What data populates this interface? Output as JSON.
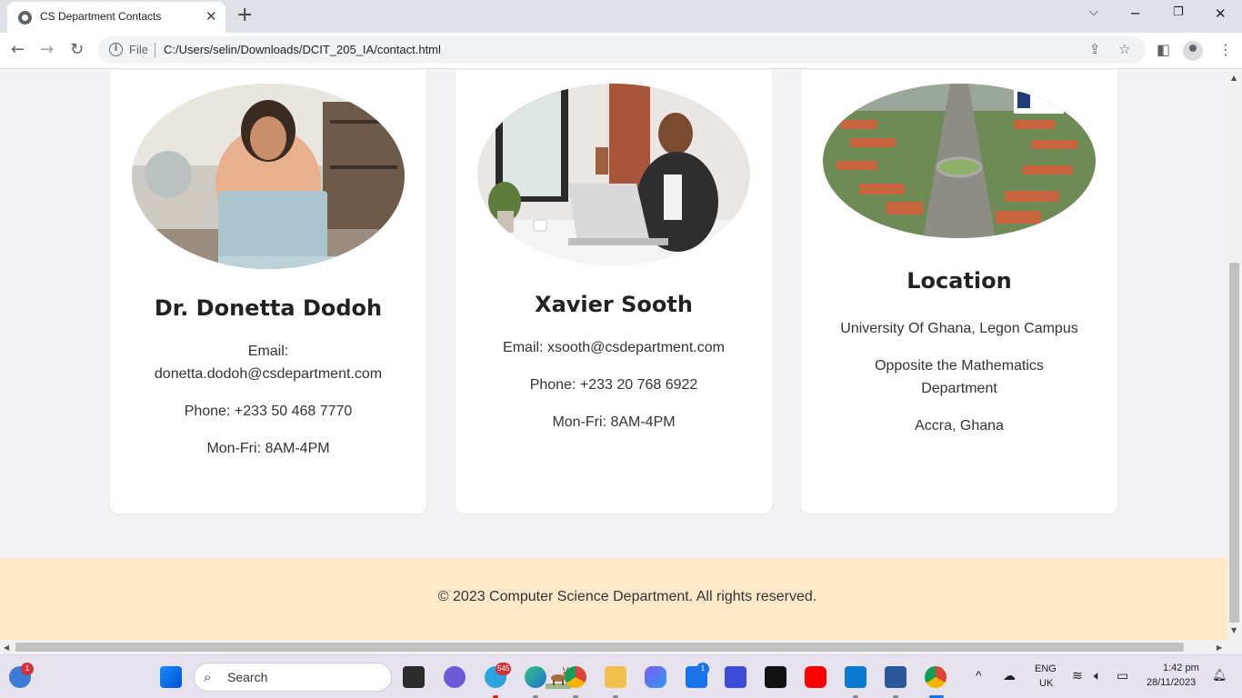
{
  "browser": {
    "tab_title": "CS Department Contacts",
    "tab_close": "✕",
    "new_tab": "+",
    "url_scheme": "File",
    "url": "C:/Users/selin/Downloads/DCIT_205_IA/contact.html"
  },
  "contacts": [
    {
      "name": "Dr. Donetta Dodoh",
      "email_label": "Email:",
      "email": "donetta.dodoh@csdepartment.com",
      "phone": "Phone: +233 50 468 7770",
      "hours": "Mon-Fri: 8AM-4PM"
    },
    {
      "name": "Xavier Sooth",
      "email_line": "Email: xsooth@csdepartment.com",
      "phone": "Phone: +233 20 768 6922",
      "hours": "Mon-Fri: 8AM-4PM"
    }
  ],
  "location": {
    "title": "Location",
    "line1": "University Of Ghana, Legon Campus",
    "line2": "Opposite the Mathematics Department",
    "line3": "Accra, Ghana"
  },
  "footer": {
    "text": "© 2023 Computer Science Department. All rights reserved."
  },
  "taskbar": {
    "search_placeholder": "Search",
    "widgets_badge": "1",
    "telegram_badge": "545",
    "mail_badge": "1",
    "language": "ENG",
    "region": "UK",
    "time": "1:42 pm",
    "date": "28/11/2023"
  },
  "colors": {
    "footer_bg": "#ffe9c9",
    "page_bg": "#f3f3f5",
    "card_bg": "#ffffff"
  }
}
